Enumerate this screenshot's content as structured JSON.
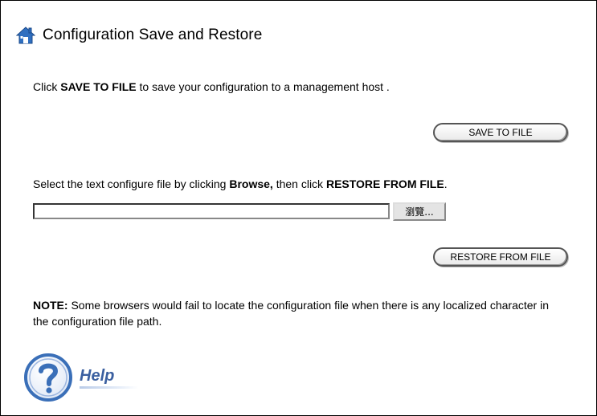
{
  "page": {
    "title": "Configuration Save and Restore"
  },
  "save": {
    "prefix": "Click ",
    "bold": "SAVE TO FILE",
    "suffix": " to save your configuration to a management host .",
    "button_label": "SAVE TO FILE"
  },
  "restore": {
    "prefix": "Select the text configure file by clicking ",
    "bold1": "Browse,",
    "middle": " then click ",
    "bold2": "RESTORE FROM FILE",
    "suffix": ".",
    "file_value": "",
    "browse_label": "瀏覽...",
    "button_label": "RESTORE FROM FILE"
  },
  "note": {
    "label": "NOTE:",
    "text": " Some browsers would fail to locate the configuration file when there is any localized character in the configuration file path."
  },
  "help": {
    "label": "Help"
  },
  "colors": {
    "home_icon": "#2f6fc0",
    "help_ring": "#3a6fb8",
    "help_text": "#3a5fa0"
  },
  "icons": {
    "title": "home-icon",
    "help": "help-question-icon"
  }
}
